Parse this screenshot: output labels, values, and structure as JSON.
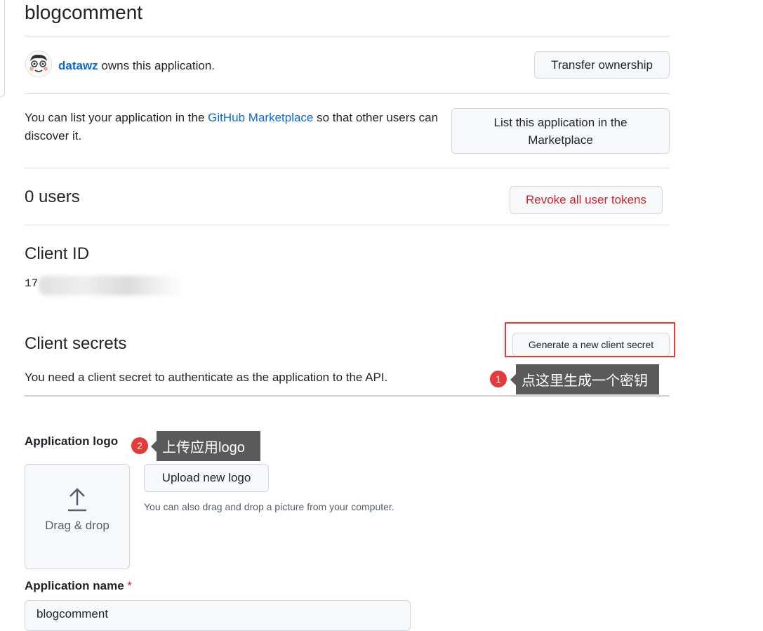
{
  "app": {
    "title": "blogcomment",
    "owner_name": "datawz",
    "owner_suffix": " owns this application.",
    "transfer_label": "Transfer ownership"
  },
  "marketplace": {
    "text_before": "You can list your application in the ",
    "link": "GitHub Marketplace",
    "text_after": " so that other users can discover it.",
    "button_label": "List this application in the Marketplace"
  },
  "users": {
    "count_label": "0 users",
    "revoke_label": "Revoke all user tokens"
  },
  "client_id": {
    "heading": "Client ID",
    "value_visible": "17"
  },
  "client_secrets": {
    "heading": "Client secrets",
    "generate_label": "Generate a new client secret",
    "description": "You need a client secret to authenticate as the application to the API."
  },
  "annotations": {
    "step1_number": "1",
    "step1_text": "点这里生成一个密钥",
    "step2_number": "2",
    "step2_text": "上传应用logo"
  },
  "logo": {
    "label": "Application logo",
    "drop_text": "Drag & drop",
    "upload_label": "Upload new logo",
    "hint": "You can also drag and drop a picture from your computer."
  },
  "app_name": {
    "label": "Application name",
    "required_mark": "*",
    "value": "blogcomment"
  },
  "colors": {
    "link": "#0969da",
    "danger": "#cf222e",
    "annotation_red": "#e5393a",
    "tooltip_bg": "#5a5a5a"
  }
}
